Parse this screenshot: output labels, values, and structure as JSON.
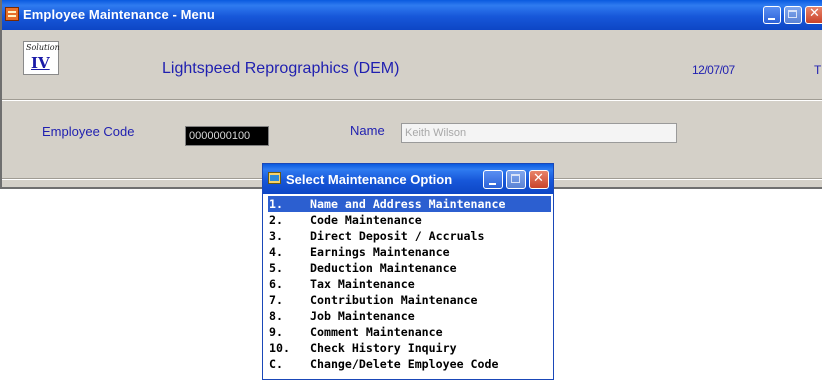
{
  "main_window": {
    "title": "Employee Maintenance - Menu",
    "logo_text_top": "Solution",
    "logo_text_bottom": "IV",
    "company": "Lightspeed Reprographics (DEM)",
    "date": "12/07/07",
    "clipped_text": "T",
    "employee_code_label": "Employee Code",
    "employee_code_value": "0000000100",
    "name_label": "Name",
    "name_value": "Keith Wilson"
  },
  "popup": {
    "title": "Select Maintenance Option",
    "selected_index": 0,
    "items": [
      {
        "num": "1.",
        "label": "Name and Address Maintenance"
      },
      {
        "num": "2.",
        "label": "Code Maintenance"
      },
      {
        "num": "3.",
        "label": "Direct Deposit / Accruals"
      },
      {
        "num": "4.",
        "label": "Earnings Maintenance"
      },
      {
        "num": "5.",
        "label": "Deduction Maintenance"
      },
      {
        "num": "6.",
        "label": "Tax Maintenance"
      },
      {
        "num": "7.",
        "label": "Contribution Maintenance"
      },
      {
        "num": "8.",
        "label": "Job Maintenance"
      },
      {
        "num": "9.",
        "label": "Comment Maintenance"
      },
      {
        "num": "10.",
        "label": "Check History Inquiry"
      },
      {
        "num": "C.",
        "label": "Change/Delete Employee Code"
      }
    ]
  },
  "colors": {
    "titlebar": "#1757d9",
    "label_text": "#1f1fb0",
    "selection": "#2c5fd0",
    "window_bg": "#d4d0c8"
  }
}
